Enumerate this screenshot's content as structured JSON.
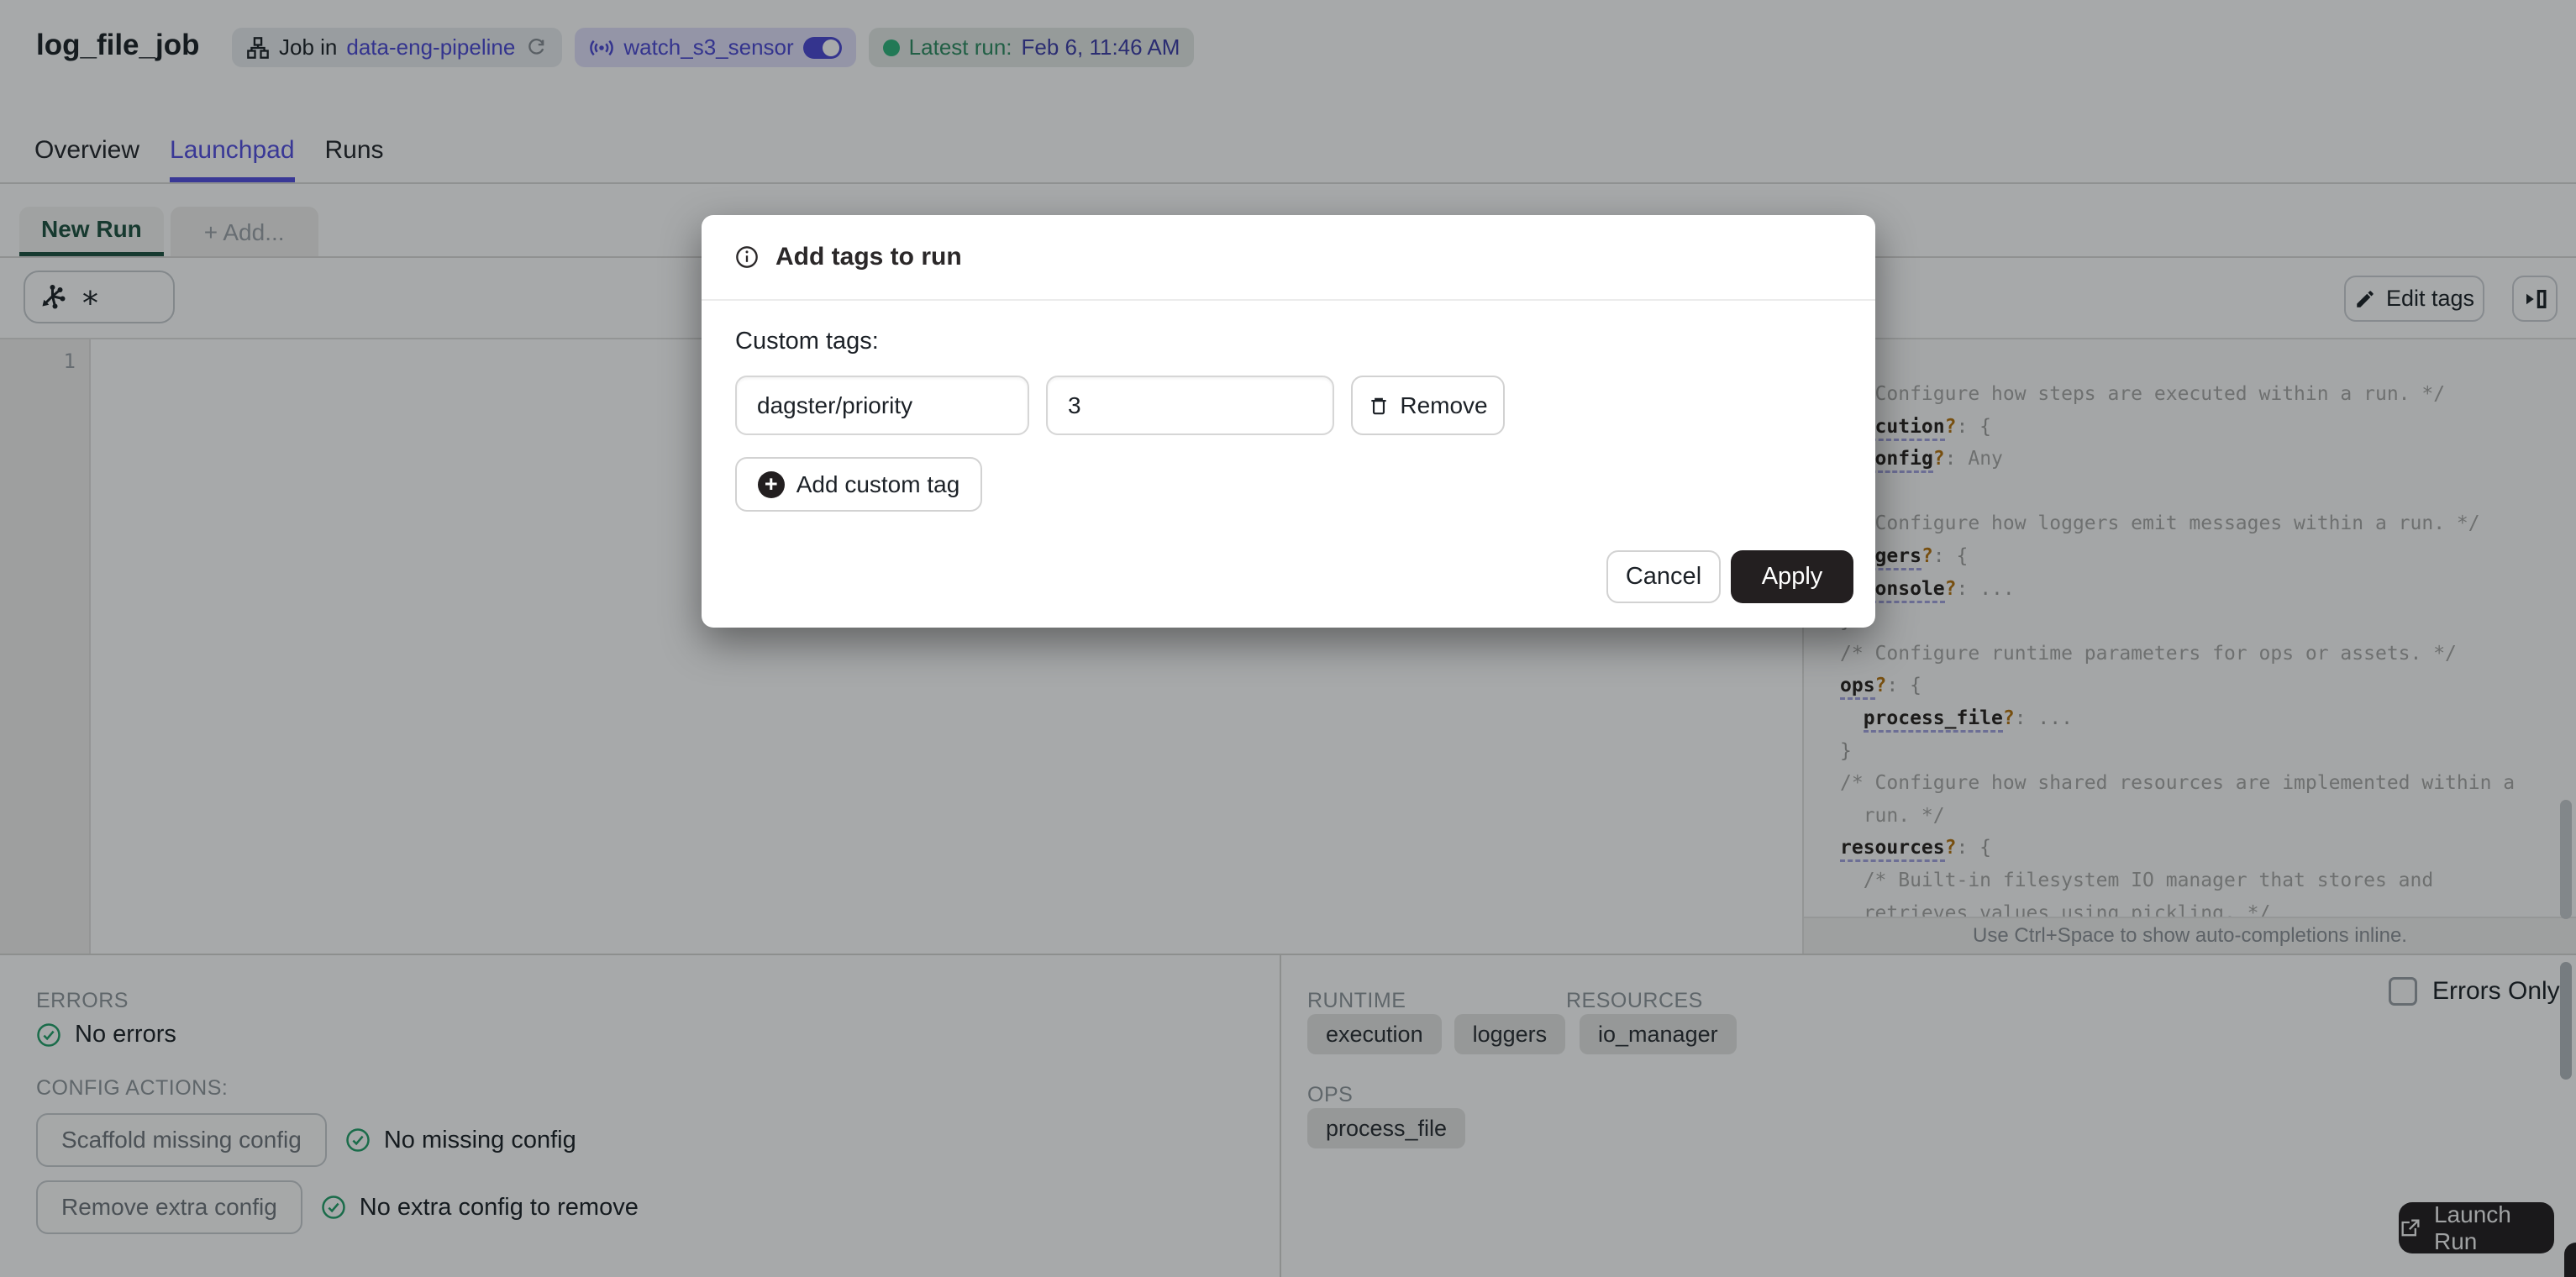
{
  "header": {
    "title": "log_file_job",
    "job_badge": {
      "prefix": "Job in",
      "link": "data-eng-pipeline"
    },
    "sensor_badge": {
      "label": "watch_s3_sensor",
      "toggle_on": true
    },
    "latest_run_badge": {
      "label": "Latest run:",
      "value": "Feb 6, 11:46 AM"
    }
  },
  "tabs": [
    {
      "label": "Overview"
    },
    {
      "label": "Launchpad"
    },
    {
      "label": "Runs"
    }
  ],
  "launchpad": {
    "run_tab": "New Run",
    "add_tab": "+ Add...",
    "op_selector_value": "*",
    "edit_tags_label": "Edit tags",
    "line_number": "1"
  },
  "modal": {
    "title": "Add tags to run",
    "section_label": "Custom tags:",
    "tag_key": "dagster/priority",
    "tag_value": "3",
    "remove_label": "Remove",
    "add_custom_tag_label": "Add custom tag",
    "cancel_label": "Cancel",
    "apply_label": "Apply"
  },
  "config_panel": {
    "footer_hint": "Use Ctrl+Space to show auto-completions inline.",
    "lines": [
      [
        [
          "cmt",
          "/* Configure how steps are executed within a run. */"
        ]
      ],
      [
        [
          "key",
          "execution"
        ],
        [
          "q",
          "?"
        ],
        [
          "p",
          ": {"
        ]
      ],
      [
        [
          "p",
          "  "
        ],
        [
          "key",
          "config"
        ],
        [
          "q",
          "?"
        ],
        [
          "p",
          ": "
        ],
        [
          "val",
          "Any"
        ]
      ],
      [
        [
          "p",
          "}"
        ]
      ],
      [
        [
          "cmt",
          "/* Configure how loggers emit messages within a run. */"
        ]
      ],
      [
        [
          "key",
          "loggers"
        ],
        [
          "q",
          "?"
        ],
        [
          "p",
          ": {"
        ]
      ],
      [
        [
          "p",
          "  "
        ],
        [
          "key",
          "console"
        ],
        [
          "q",
          "?"
        ],
        [
          "p",
          ": ..."
        ]
      ],
      [
        [
          "p",
          "}"
        ]
      ],
      [
        [
          "cmt",
          "/* Configure runtime parameters for ops or assets. */"
        ]
      ],
      [
        [
          "key",
          "ops"
        ],
        [
          "q",
          "?"
        ],
        [
          "p",
          ": {"
        ]
      ],
      [
        [
          "p",
          "  "
        ],
        [
          "key",
          "process_file"
        ],
        [
          "q",
          "?"
        ],
        [
          "p",
          ": ..."
        ]
      ],
      [
        [
          "p",
          "}"
        ]
      ],
      [
        [
          "cmt",
          "/* Configure how shared resources are implemented within a"
        ]
      ],
      [
        [
          "cmt",
          "  run. */"
        ]
      ],
      [
        [
          "key",
          "resources"
        ],
        [
          "q",
          "?"
        ],
        [
          "p",
          ": {"
        ]
      ],
      [
        [
          "cmt",
          "  /* Built-in filesystem IO manager that stores and"
        ]
      ],
      [
        [
          "cmt",
          "  retrieves values using pickling. */"
        ]
      ]
    ]
  },
  "bottom_left": {
    "errors_label": "ERRORS",
    "no_errors": "No errors",
    "config_actions_label": "CONFIG ACTIONS:",
    "scaffold_button": "Scaffold missing config",
    "no_missing": "No missing config",
    "remove_button": "Remove extra config",
    "no_extra": "No extra config to remove"
  },
  "bottom_right": {
    "runtime_label": "RUNTIME",
    "runtime_tags": [
      "execution",
      "loggers"
    ],
    "resources_label": "RESOURCES",
    "resources_tags": [
      "io_manager"
    ],
    "ops_label": "OPS",
    "ops_tags": [
      "process_file"
    ],
    "errors_only_label": "Errors Only"
  },
  "launch": {
    "label": "Launch Run"
  },
  "colors": {
    "accent": "#544FE0",
    "link": "#4B49D4",
    "tab_green": "#1E5240",
    "check_green": "#23A06A",
    "dark_button": "#231F20"
  }
}
